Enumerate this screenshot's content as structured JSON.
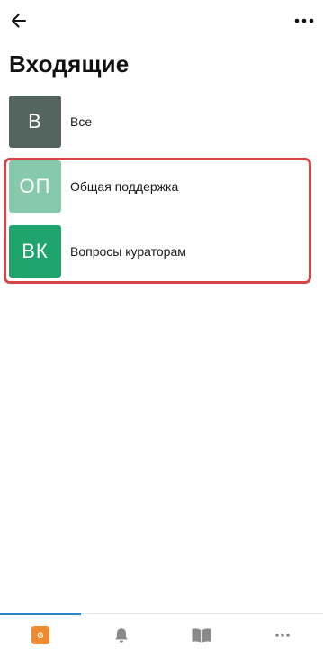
{
  "header": {
    "back_icon": "arrow-left-icon",
    "more_icon": "more-horizontal-icon",
    "title": "Входящие"
  },
  "inboxes": [
    {
      "initials": "В",
      "label": "Все",
      "color": "#54655f"
    },
    {
      "initials": "ОП",
      "label": "Общая поддержка",
      "color": "#86c9ab"
    },
    {
      "initials": "ВК",
      "label": "Вопросы кураторам",
      "color": "#1ea46c"
    }
  ],
  "highlight": {
    "color": "#d64548"
  },
  "bottom_nav": {
    "active_color": "#2a84c8",
    "tabs": [
      {
        "icon": "app-logo-icon",
        "text": "G",
        "color": "#f08a2e"
      },
      {
        "icon": "bell-icon"
      },
      {
        "icon": "book-icon"
      },
      {
        "icon": "more-horizontal-icon"
      }
    ]
  }
}
